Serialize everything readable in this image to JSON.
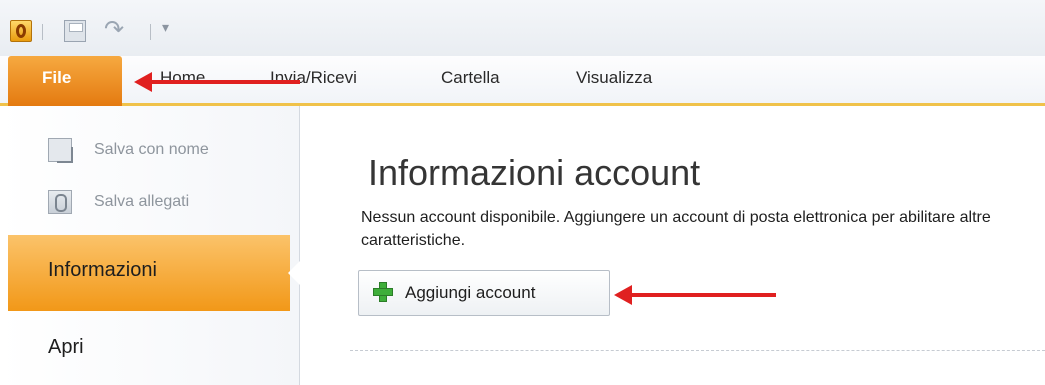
{
  "quick_access": {
    "app_icon": "outlook-icon",
    "save_icon": "save-icon",
    "undo_icon": "undo-icon",
    "customize_icon": "customize-dropdown-icon"
  },
  "ribbon": {
    "tabs": [
      {
        "label": "File"
      },
      {
        "label": "Home"
      },
      {
        "label": "Invia/Ricevi"
      },
      {
        "label": "Cartella"
      },
      {
        "label": "Visualizza"
      }
    ]
  },
  "backstage_nav": {
    "commands": [
      {
        "label": "Salva con nome",
        "icon": "save-as-icon"
      },
      {
        "label": "Salva allegati",
        "icon": "save-attachments-icon"
      }
    ],
    "items": [
      {
        "label": "Informazioni"
      },
      {
        "label": "Apri"
      }
    ]
  },
  "main": {
    "title": "Informazioni account",
    "description_line1": "Nessun account disponibile. Aggiungere un account di posta elettronica per abilitare altre",
    "description_line2": "caratteristiche.",
    "add_account_label": "Aggiungi account",
    "add_account_icon": "plus-icon"
  },
  "colors": {
    "file_tab": "#e47a10",
    "active_nav": "#f29818",
    "annotation_arrow": "#e02020"
  }
}
